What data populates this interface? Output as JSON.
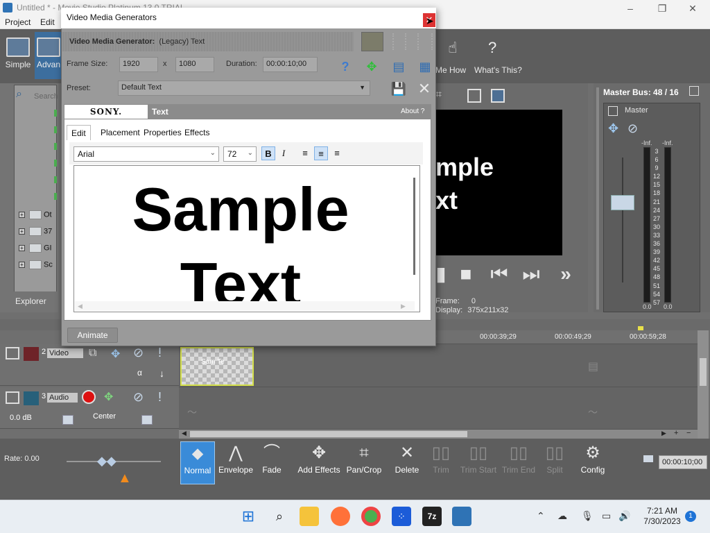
{
  "app": {
    "title": "Untitled * - Movie Studio Platinum 13.0 TRIAL",
    "window_controls": [
      "–",
      "❐",
      "✕"
    ],
    "menu": [
      "Project",
      "Edit"
    ]
  },
  "toolbar": {
    "simple_label": "Simple",
    "advanced_label": "Advan",
    "show_me_how_label": "Me How",
    "whats_this_label": "What's This?"
  },
  "explorer": {
    "search_placeholder": "Search",
    "tree_items": [
      "Ot",
      "37",
      "GI",
      "Sc"
    ],
    "tab_label": "Explorer"
  },
  "preview": {
    "text": "mple\nxt",
    "frame_label": "Frame:",
    "frame_value": "0",
    "display_label": "Display:",
    "display_value": "375x211x32"
  },
  "master": {
    "title": "Master Bus: 48 / 16",
    "label": "Master",
    "meter_top_left": "-Inf.",
    "meter_top_right": "-Inf.",
    "scale": [
      "3",
      "6",
      "9",
      "12",
      "15",
      "18",
      "21",
      "24",
      "27",
      "30",
      "33",
      "36",
      "39",
      "42",
      "45",
      "48",
      "51",
      "54",
      "57"
    ],
    "bottom_left": "0.0",
    "bottom_right": "0.0"
  },
  "timeline": {
    "marks": [
      "9",
      "00:00:39;29",
      "00:00:49;29",
      "00:00:59;28"
    ],
    "video_track": {
      "number": "2",
      "name": "Video"
    },
    "audio_track": {
      "number": "3",
      "name": "Audio",
      "volume": "0.0 dB",
      "pan": "Center"
    },
    "clip_label": "Sam Te"
  },
  "edit_toolbar": {
    "rate": "Rate: 0.00",
    "buttons": [
      "Normal",
      "Envelope",
      "Fade",
      "Add Effects",
      "Pan/Crop",
      "Delete",
      "Trim",
      "Trim Start",
      "Trim End",
      "Split",
      "Config"
    ],
    "time": "00:00:10;00"
  },
  "dialog": {
    "title": "Video Media Generators",
    "close": "✕",
    "header_label": "Video Media Generator:",
    "header_value": "(Legacy) Text",
    "frame_size_label": "Frame Size:",
    "width": "1920",
    "x": "x",
    "height": "1080",
    "duration_label": "Duration:",
    "duration": "00:00:10;00",
    "preset_label": "Preset:",
    "preset": "Default Text",
    "brand": "SONY.",
    "generator_name": "Text",
    "about": "About",
    "tabs": [
      "Edit",
      "Placement",
      "Properties",
      "Effects"
    ],
    "font": "Arial",
    "font_size": "72",
    "bold": "B",
    "italic": "I",
    "sample_line1": "Sample",
    "sample_line2": "Text",
    "animate": "Animate"
  },
  "taskbar": {
    "time": "7:21 AM",
    "date": "7/30/2023",
    "notification_count": "1"
  },
  "colors": {
    "accent": "#3a8bd8",
    "close_red": "#d33333",
    "clip_border": "#d4e04a"
  }
}
